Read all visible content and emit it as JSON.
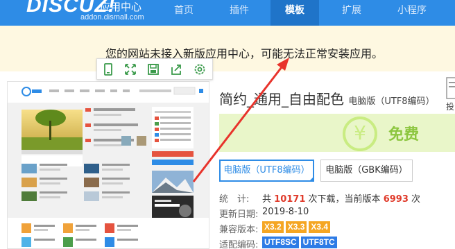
{
  "header": {
    "logo": "DISCUZ!",
    "logo_cn": "应用中心",
    "logo_sub": "addon.dismall.com",
    "nav": [
      {
        "label": "首页",
        "active": false
      },
      {
        "label": "插件",
        "active": false
      },
      {
        "label": "模板",
        "active": true
      },
      {
        "label": "扩展",
        "active": false
      },
      {
        "label": "小程序",
        "active": false
      }
    ]
  },
  "notice": {
    "text": "您的网站未接入新版应用中心，可能无法正常安装应用。"
  },
  "toolbar": {
    "icons": [
      "mobile-icon",
      "fullscreen-icon",
      "save-icon",
      "share-icon",
      "settings-icon"
    ]
  },
  "product": {
    "title": "简约_通用_自由配色",
    "title_sub": "电脑版（UTF8编码）",
    "price_symbol": "¥",
    "price": "免费",
    "tabs": [
      {
        "label": "电脑版（UTF8编码）",
        "active": true
      },
      {
        "label": "电脑版（GBK编码）",
        "active": false
      }
    ],
    "stats_label": "统　计:",
    "stats_prefix": "共",
    "downloads": "10171",
    "stats_mid": "次下载，当前版本",
    "current": "6993",
    "stats_suffix": "次",
    "updated_label": "更新日期:",
    "updated": "2019-8-10",
    "compat_label": "兼容版本:",
    "compat": [
      "X3.2",
      "X3.3",
      "X3.4"
    ],
    "encoding_label": "适配编码:",
    "encoding": [
      "UTF8SC",
      "UTF8TC"
    ],
    "side_label": "投"
  },
  "colors": {
    "brand": "#2e8ce6",
    "notice_bg": "#fef8e1",
    "price_green": "#8cc63f",
    "badge_orange": "#f5a623",
    "badge_blue": "#2e7ce6",
    "count_red": "#e03b2b"
  }
}
